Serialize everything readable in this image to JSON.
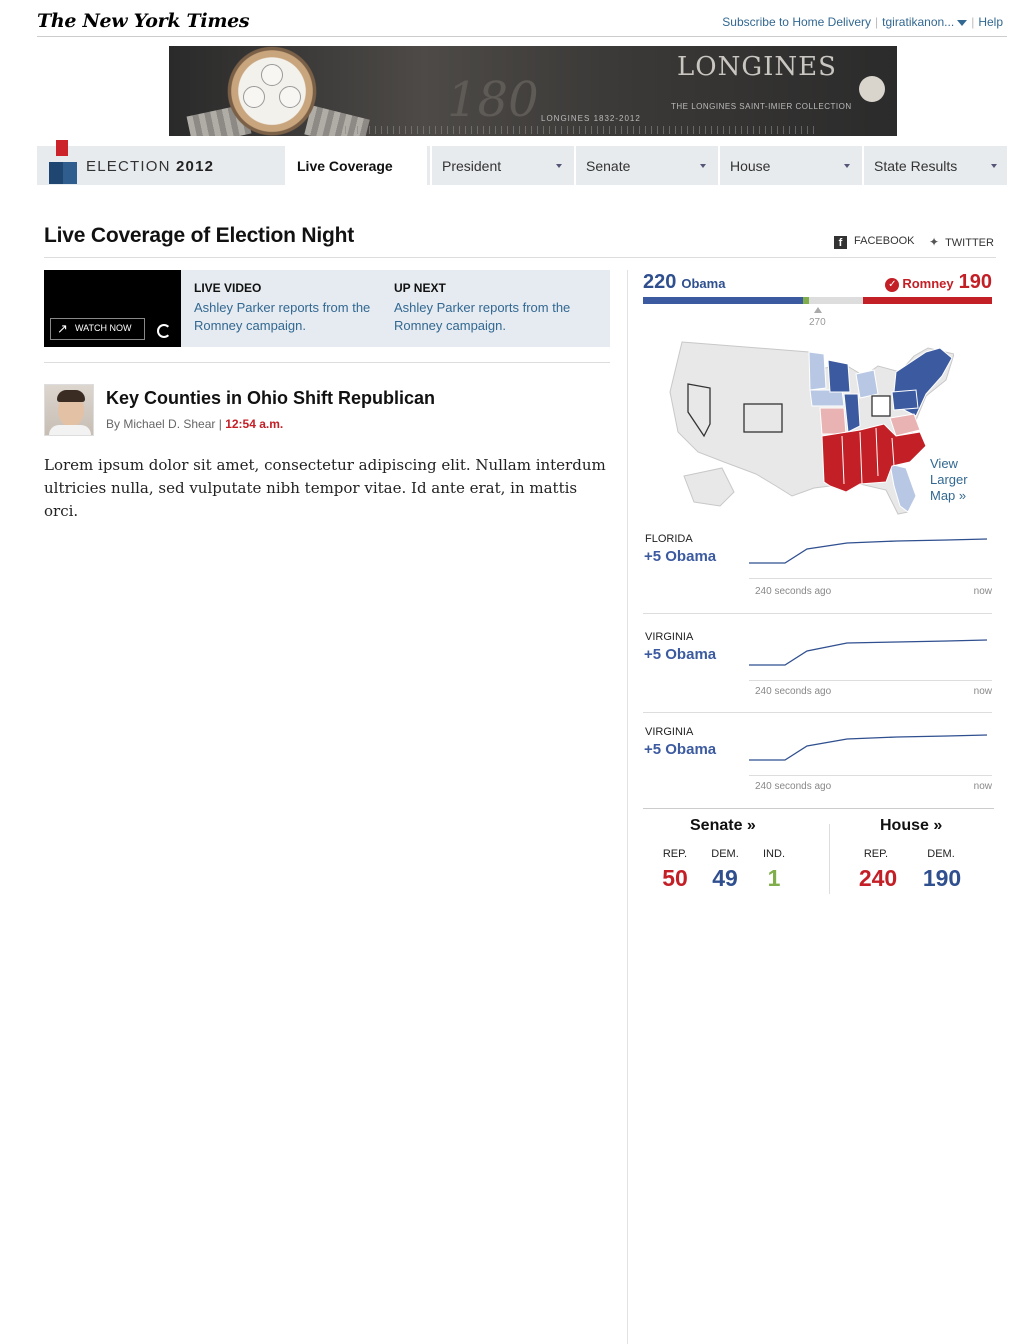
{
  "masthead": {
    "logo": "The New York Times",
    "subscribe": "Subscribe to Home Delivery",
    "user": "tgiratikanon...",
    "help": "Help"
  },
  "ad": {
    "number": "180",
    "years": "LONGINES 1832-2012",
    "brand": "LONGINES",
    "collection": "THE LONGINES SAINT-IMIER COLLECTION"
  },
  "election_nav": {
    "brand_light": "ELECTION",
    "brand_bold": "2012",
    "tabs": [
      {
        "label": "Live Coverage"
      },
      {
        "label": "President"
      },
      {
        "label": "Senate"
      },
      {
        "label": "House"
      },
      {
        "label": "State Results"
      }
    ]
  },
  "page": {
    "title": "Live Coverage of Election Night",
    "facebook": "FACEBOOK",
    "twitter": "TWITTER"
  },
  "video": {
    "watch_label": "WATCH NOW",
    "live_heading": "LIVE VIDEO",
    "live_text": "Ashley Parker reports from the Romney campaign.",
    "next_heading": "UP NEXT",
    "next_text": "Ashley Parker reports from the Romney campaign."
  },
  "post": {
    "title": "Key Counties in Ohio Shift Republican",
    "byline": "By Michael D. Shear",
    "time": "12:54 a.m.",
    "body": "Lorem ipsum dolor sit amet, consectetur adipiscing elit. Nullam interdum ultricies nulla, sed vulputate nibh tempor vitae. Id ante erat, in mattis orci."
  },
  "electoral": {
    "obama_votes": "220",
    "obama_name": "Obama",
    "romney_votes": "190",
    "romney_name": "Romney",
    "threshold": "270",
    "view_map": "View Larger Map »",
    "colors": {
      "dem": "#3c5aa0",
      "rep": "#c31f26",
      "ind": "#7fae4b"
    }
  },
  "races": [
    {
      "state": "FLORIDA",
      "margin": "+5 Obama",
      "ago": "240 seconds ago",
      "now": "now"
    },
    {
      "state": "VIRGINIA",
      "margin": "+5 Obama",
      "ago": "240 seconds ago",
      "now": "now"
    },
    {
      "state": "VIRGINIA",
      "margin": "+5 Obama",
      "ago": "240 seconds ago",
      "now": "now"
    }
  ],
  "congress": {
    "senate": {
      "title": "Senate »",
      "rep_label": "REP.",
      "dem_label": "DEM.",
      "ind_label": "IND.",
      "rep": "50",
      "dem": "49",
      "ind": "1"
    },
    "house": {
      "title": "House »",
      "rep_label": "REP.",
      "dem_label": "DEM.",
      "rep": "240",
      "dem": "190"
    }
  }
}
